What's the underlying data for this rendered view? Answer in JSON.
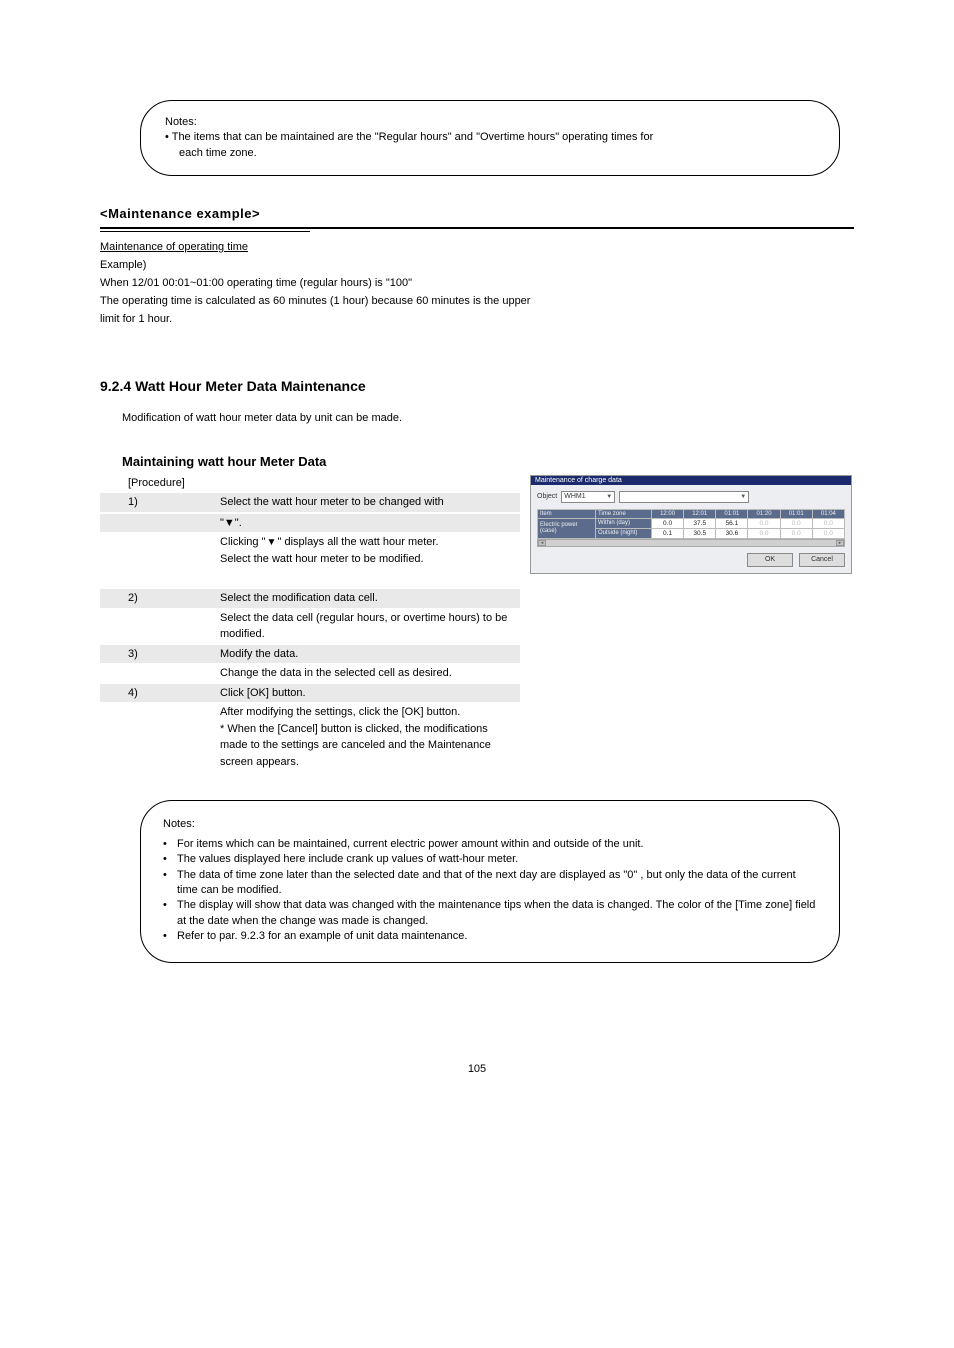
{
  "note_top": {
    "heading": "Notes:",
    "line1": "The items that can be maintained are the \"Regular hours\" and \"Overtime hours\" operating times for",
    "line2": "each time zone."
  },
  "maint_example_heading": "<Maintenance example>",
  "maint_example": {
    "underline_label": "Maintenance of operating time",
    "line1": "Example)",
    "line2": "When 12/01 00:01~01:00 operating time (regular hours) is \"100\"",
    "line3": "The operating time is calculated as 60 minutes (1 hour) because 60 minutes is the upper",
    "line4": "limit for 1 hour."
  },
  "section_number": "9.2.4",
  "section_title": "Watt Hour Meter Data Maintenance",
  "section_intro": "Modification of watt hour meter data by unit can be made.",
  "subhead": "Maintaining watt hour Meter Data",
  "procedure_label": "[Procedure]",
  "steps": {
    "step1_num": "1)",
    "step1_text": "Select the watt hour meter to be changed with",
    "step1_tri1": "\"▼\".",
    "step1_tri2_pre": "Clicking \"",
    "step1_tri2_suf": "\" displays all the watt hour meter.",
    "step1_after": "Select the watt hour meter to be modified.",
    "step2_num": "2)",
    "step2_text": "Select the modification data cell.",
    "step2_after": "Select the data cell (regular hours, or overtime hours) to be modified.",
    "step3_num": "3)",
    "step3_text": "Modify the data.",
    "step3_after": "Change the data in the selected cell as desired.",
    "step4_num": "4)",
    "step4_text": "Click [OK] button.",
    "step4_line2": "After modifying the settings, click the [OK] button.",
    "step4_line3": "* When the [Cancel] button is clicked, the modifications",
    "step4_line4": "made to the settings are canceled and the Maintenance",
    "step4_line5": "screen appears."
  },
  "note_bottom": {
    "heading": "Notes:",
    "items": [
      "For items which can be maintained, current electric power amount within and outside of the unit.",
      "The values displayed here include crank up values of watt-hour meter.",
      "The data of time zone later than the selected date and that of the next day are displayed as \"0\" , but only the data of the current time can be modified.",
      "The display will show that data was changed with the maintenance tips when the data is changed. The color of the [Time zone] field at the date when the change was made is changed.",
      "Refer to par. 9.2.3 for an example of unit data maintenance."
    ]
  },
  "screenshot": {
    "title": "Maintenance of charge data",
    "object_label": "Object",
    "object_value": "WHM1",
    "table": {
      "row_header": "Item",
      "time_label": "Time zone",
      "left_rows": [
        "Electric power",
        "(case)"
      ],
      "left_rows2": [
        "Within (day)",
        "Outside (night)"
      ],
      "time_cols": [
        "12:00",
        "12:01",
        "01:01",
        "01:20",
        "01:01",
        "01:04"
      ],
      "row1": [
        "0.0",
        "37.5",
        "56.1",
        "0.0",
        "0.0",
        "0.0"
      ],
      "row2": [
        "0.1",
        "30.5",
        "30.6",
        "0.0",
        "0.0",
        "0.0"
      ]
    },
    "ok": "OK",
    "cancel": "Cancel"
  },
  "page_number": "105"
}
